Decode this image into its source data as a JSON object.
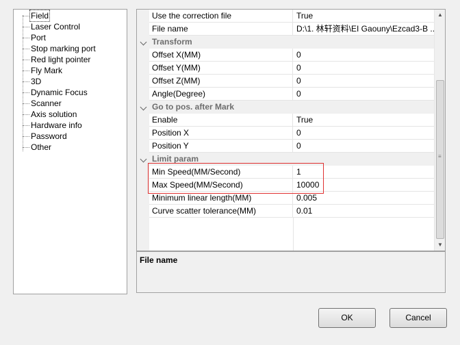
{
  "tree": {
    "items": [
      {
        "label": "Field",
        "selected": true
      },
      {
        "label": "Laser Control"
      },
      {
        "label": "Port"
      },
      {
        "label": "Stop marking port"
      },
      {
        "label": "Red light pointer"
      },
      {
        "label": "Fly Mark"
      },
      {
        "label": "3D"
      },
      {
        "label": "Dynamic Focus"
      },
      {
        "label": "Scanner"
      },
      {
        "label": "Axis solution"
      },
      {
        "label": "Hardware info"
      },
      {
        "label": "Password"
      },
      {
        "label": "Other"
      }
    ]
  },
  "grid": {
    "rows": [
      {
        "type": "prop",
        "name": "Use the correction file",
        "value": "True"
      },
      {
        "type": "prop",
        "name": "File name",
        "value": "D:\\1. 林轩资料\\EI Gaouny\\Ezcad3-B ..."
      },
      {
        "type": "cat",
        "name": "Transform"
      },
      {
        "type": "prop",
        "name": "Offset X(MM)",
        "value": "0"
      },
      {
        "type": "prop",
        "name": "Offset Y(MM)",
        "value": "0"
      },
      {
        "type": "prop",
        "name": "Offset Z(MM)",
        "value": "0"
      },
      {
        "type": "prop",
        "name": "Angle(Degree)",
        "value": "0"
      },
      {
        "type": "cat",
        "name": "Go to pos. after Mark"
      },
      {
        "type": "prop",
        "name": "Enable",
        "value": "True"
      },
      {
        "type": "prop",
        "name": "Position X",
        "value": "0"
      },
      {
        "type": "prop",
        "name": "Position Y",
        "value": "0"
      },
      {
        "type": "cat",
        "name": "Limit param"
      },
      {
        "type": "prop",
        "name": "Min Speed(MM/Second)",
        "value": "1"
      },
      {
        "type": "prop",
        "name": "Max Speed(MM/Second)",
        "value": "10000"
      },
      {
        "type": "prop",
        "name": "Minimum linear length(MM)",
        "value": "0.005"
      },
      {
        "type": "prop",
        "name": "Curve scatter tolerance(MM)",
        "value": "0.01"
      }
    ]
  },
  "description": {
    "title": "File name"
  },
  "buttons": {
    "ok": "OK",
    "cancel": "Cancel"
  },
  "colors": {
    "highlight": "#e03030",
    "category_text": "#6d6d6d"
  }
}
